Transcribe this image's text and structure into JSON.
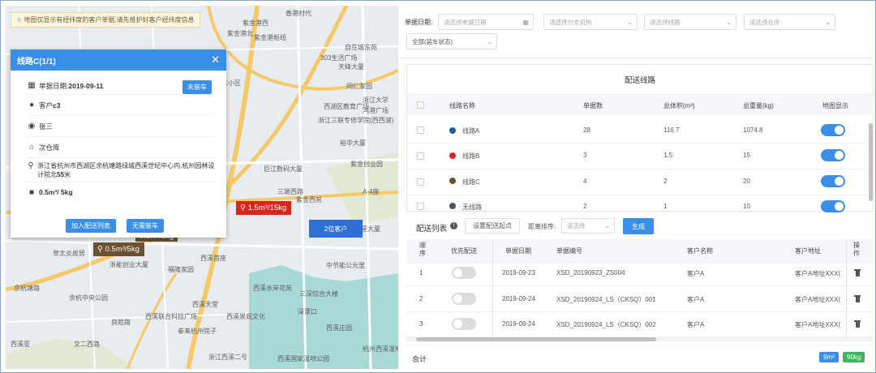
{
  "map": {
    "notice": "☆ 地图仅显示有经纬度的客户单据,请先维护好客户经纬度信息",
    "labels": [
      "紫金港西",
      "紫金港北",
      "香港时代",
      "紫金港枢纽",
      "豫东小区",
      "303生活广场",
      "自在城东苑",
      "天峰大厦",
      "同仁家园",
      "浙江大学",
      "西湖区教育广场",
      "浙江三联专修学院(西西湖)",
      "鸿港广场",
      "浙江三联专修学院(西西九路)",
      "裕华大厦",
      "紫金创业园",
      "巨江数码大厦",
      "三墩西路",
      "紫金西苑",
      "A-4座",
      "华兴大厦",
      "金星大厦",
      "草太炎故居",
      "浙能创业大厦",
      "福隆家园",
      "西溪首座",
      "余杭塘路",
      "西溪水岸花苑",
      "三深综合大楼",
      "余杭中央公园",
      "西溪天堂",
      "深潭口",
      "中节能公元里",
      "西溪联合科技广场",
      "西溪景观文化",
      "拳来杭州院子",
      "浙江西溪二号",
      "西溪国家湿地公园",
      "杭州西溪湿地",
      "西溪庄园",
      "良睦路",
      "文二西路",
      "西溪亚",
      "杭州西"
    ],
    "markers": {
      "red": "1.5m³/15kg",
      "brown1": "0.5m³/5kg",
      "brown2": "0.5m³/5kg",
      "cluster": "2位客户"
    },
    "popup": {
      "title": "线路C(1/1)",
      "date_label": "单据日期:",
      "date_value": "2019-09-11",
      "status_btn": "未装车",
      "customer_prefix": "客户",
      "customer": "c3",
      "contact": "张三",
      "warehouse": "次仓库",
      "address": "浙江省杭州市西湖区余杭塘路绿城西溪世纪中心内,杭州园林设计院北",
      "address_num": "55",
      "address_suffix": "米",
      "volume": "0.5m³/ 5kg",
      "btn_add": "加入配送列表",
      "btn_no_load": "无需装车"
    }
  },
  "filters": {
    "date_label": "单据日期:",
    "date_placeholder": "请选择单据日期",
    "branch_placeholder": "请选择分支机构",
    "route_placeholder": "请选择线路",
    "warehouse_placeholder": "请选择仓库",
    "status_value": "全部(装车状态)"
  },
  "routes": {
    "title": "配送线路",
    "headers": [
      "线路名称",
      "单据数",
      "总体积(m³)",
      "总重量(kg)",
      "地图显示"
    ],
    "rows": [
      {
        "name": "线路A",
        "color": "#1f5f9a",
        "count": "28",
        "volume": "116.7",
        "weight": "1074.8"
      },
      {
        "name": "线路B",
        "color": "#e0242b",
        "count": "3",
        "volume": "1.5",
        "weight": "15"
      },
      {
        "name": "线路C",
        "color": "#6b5233",
        "count": "4",
        "volume": "2",
        "weight": "20"
      },
      {
        "name": "无线路",
        "color": "#4c5566",
        "count": "2",
        "volume": "1",
        "weight": "10"
      }
    ]
  },
  "delivery": {
    "title": "配送列表",
    "set_start": "设置配送起点",
    "sort_label": "距离排序:",
    "sort_placeholder": "请选择",
    "generate": "生成",
    "headers": [
      "顺\n序",
      "优先配送",
      "单据日期",
      "单据编号",
      "客户名称",
      "客户地址",
      "操\n作"
    ],
    "h_seq": "顺",
    "h_seq2": "序",
    "h_op": "操",
    "h_op2": "作",
    "rows": [
      {
        "seq": "1",
        "date": "2019-09-23",
        "no": "XSD_20190923_ZS004",
        "customer": "客户A",
        "address": "客户A地址XXX("
      },
      {
        "seq": "2",
        "date": "2019-09-24",
        "no": "XSD_20190924_LS（CKSQ）001",
        "customer": "客户A",
        "address": "客户A地址XXX("
      },
      {
        "seq": "3",
        "date": "2019-09-24",
        "no": "XSD_20190924_LS（CKSQ）002",
        "customer": "客户A",
        "address": "客户A地址XXX("
      }
    ],
    "total_label": "合计",
    "total_volume": "9m³",
    "total_weight": "90kg"
  }
}
